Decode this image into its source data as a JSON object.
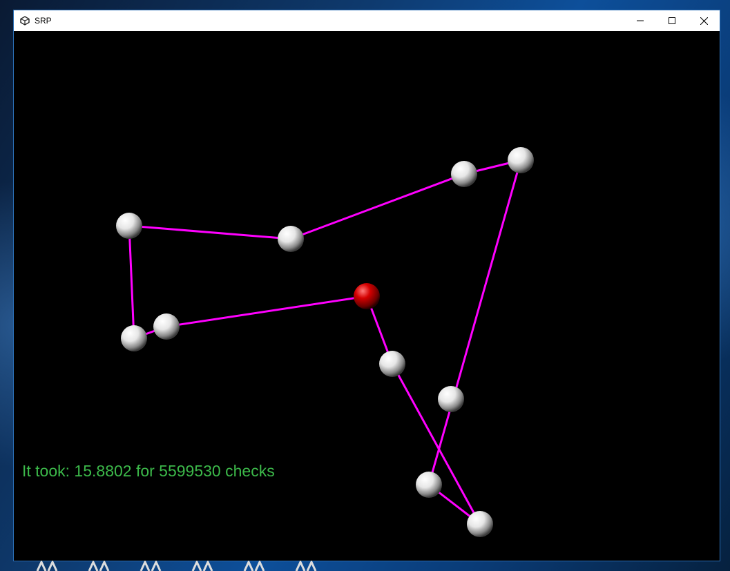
{
  "window": {
    "title": "SRP",
    "icon": "unity-icon",
    "controls": [
      "minimize-icon",
      "maximize-icon",
      "close-icon"
    ]
  },
  "scene": {
    "status_text": "It took: 15.8802 for 5599530 checks",
    "line_color": "#ff00ff",
    "status_color": "#3cb94a",
    "node_color": "#e8e8e8",
    "highlight_node_color": "#cc0000",
    "background_color": "#000000"
  }
}
